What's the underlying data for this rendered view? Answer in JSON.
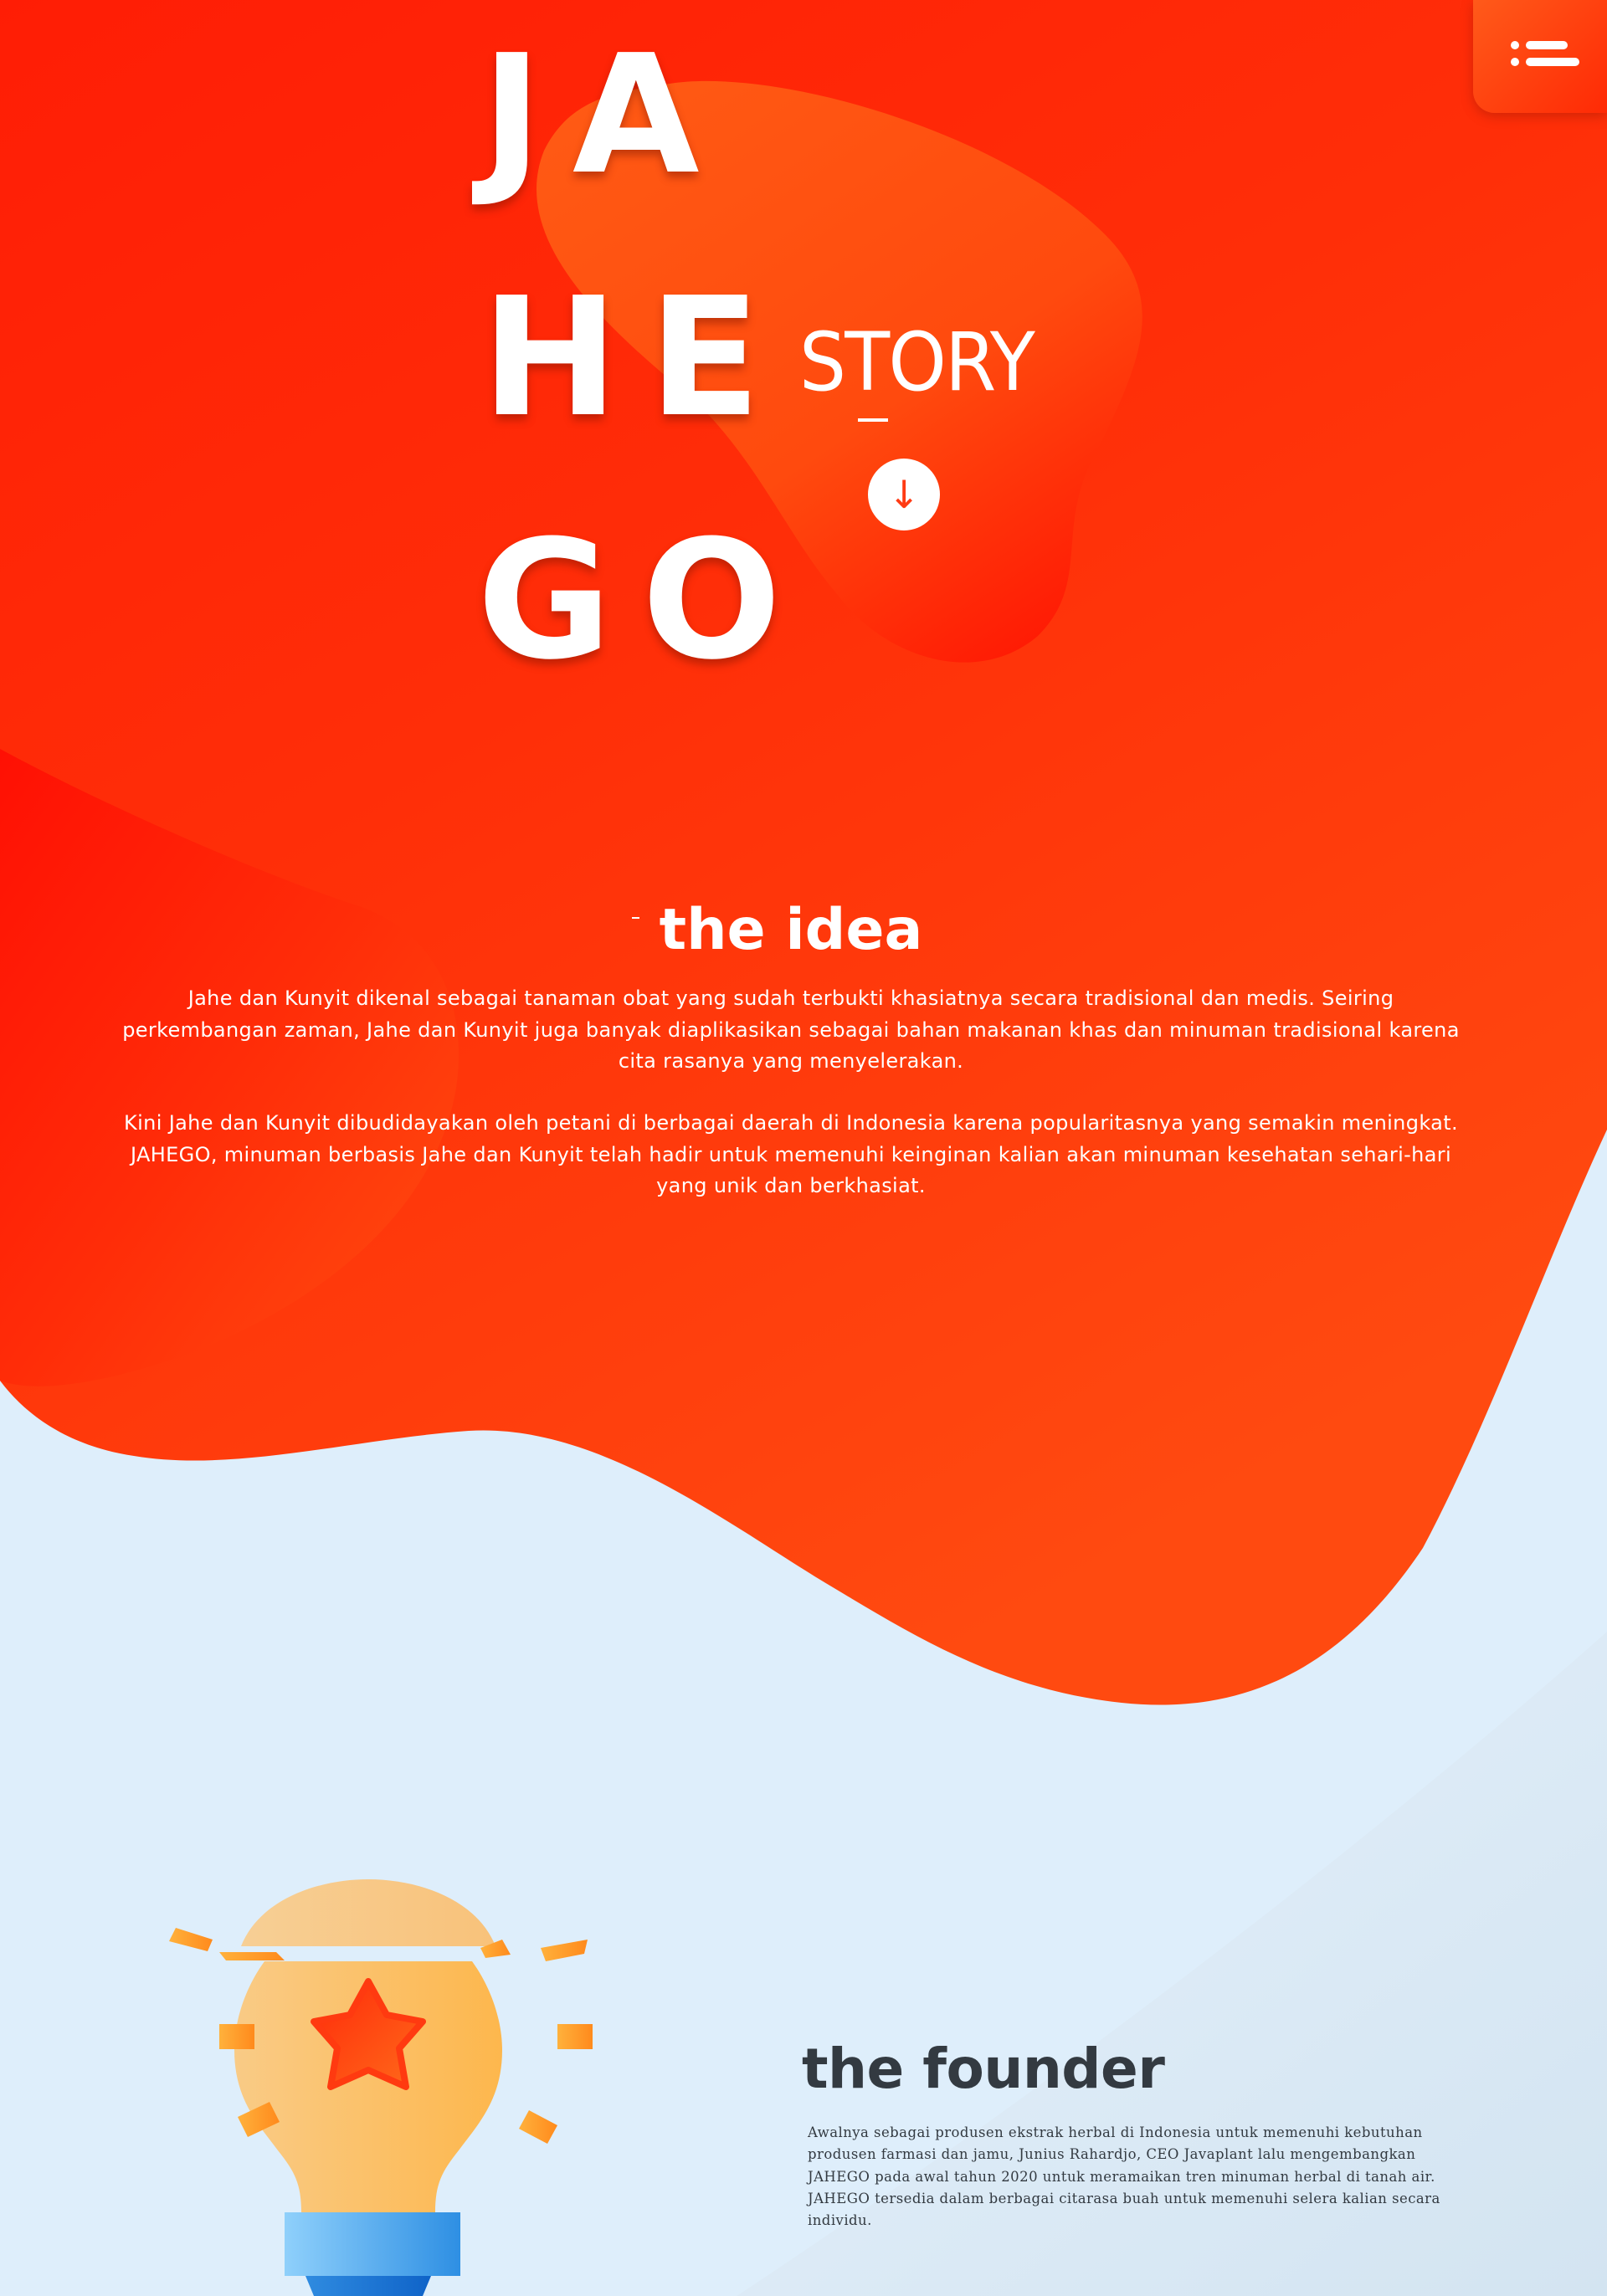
{
  "brand": {
    "row1": "JA",
    "row2": "HE",
    "row3": "GO",
    "subtitle": "STORY"
  },
  "nav": {
    "menu_icon": "menu-list-icon",
    "scroll_icon": "arrow-down-icon",
    "scroll_glyph": "↓"
  },
  "idea": {
    "title": "the idea",
    "paragraphs": [
      "Jahe dan Kunyit dikenal sebagai tanaman obat yang sudah terbukti khasiatnya secara tradisional dan medis. Seiring perkembangan zaman, Jahe dan Kunyit juga banyak diaplikasikan sebagai bahan makanan khas dan minuman tradisional karena cita rasanya yang menyelerakan.",
      "Kini Jahe dan Kunyit dibudidayakan oleh petani di berbagai daerah di Indonesia karena popularitasnya yang semakin meningkat. JAHEGO, minuman berbasis Jahe dan Kunyit telah hadir untuk memenuhi keinginan kalian akan minuman kesehatan sehari-hari yang unik dan berkhasiat."
    ]
  },
  "founder": {
    "title": "the founder",
    "text": "Awalnya sebagai produsen ekstrak herbal di Indonesia untuk memenuhi kebutuhan produsen farmasi dan jamu, Junius Rahardjo, CEO Javaplant lalu mengembangkan JAHEGO pada awal tahun 2020 untuk meramaikan tren minuman herbal di tanah air. JAHEGO tersedia dalam berbagai citarasa buah untuk memenuhi selera kalian secara individu.",
    "illustration_icon": "lightbulb-star-icon"
  },
  "colors": {
    "orange_top": "#ff2405",
    "orange_mid": "#ff4d12",
    "orange_light": "#ff5c14",
    "background_blue": "#deeefb",
    "text_dark": "#333a41",
    "white": "#ffffff"
  }
}
